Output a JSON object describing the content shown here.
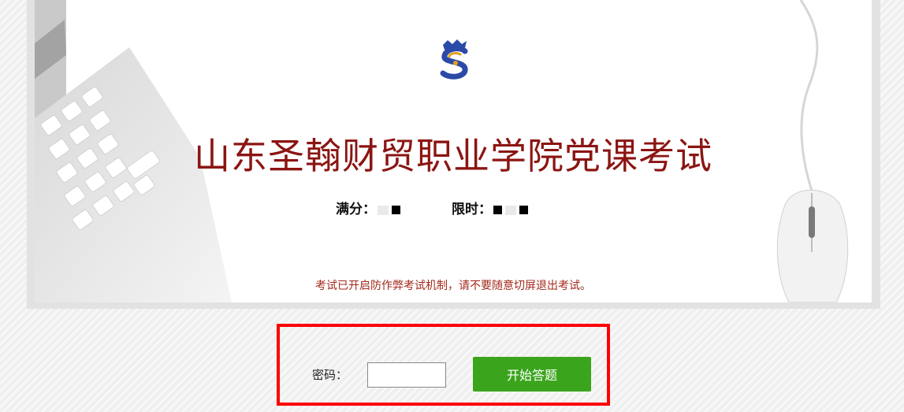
{
  "exam": {
    "title": "山东圣翰财贸职业学院党课考试",
    "full_score_label": "满分：",
    "time_limit_label": "限时：",
    "notice": "考试已开启防作弊考试机制，请不要随意切屏退出考试。"
  },
  "logo": {
    "icon": "dragon-s-logo-icon",
    "colors": [
      "#2b4aa8",
      "#e0a020"
    ]
  },
  "form": {
    "password_label": "密码：",
    "password_value": "",
    "password_placeholder": "",
    "start_button_label": "开始答题"
  },
  "colors": {
    "title": "#8b1512",
    "notice": "#a32a1b",
    "button": "#3aa51c",
    "highlight": "#ff0000"
  }
}
